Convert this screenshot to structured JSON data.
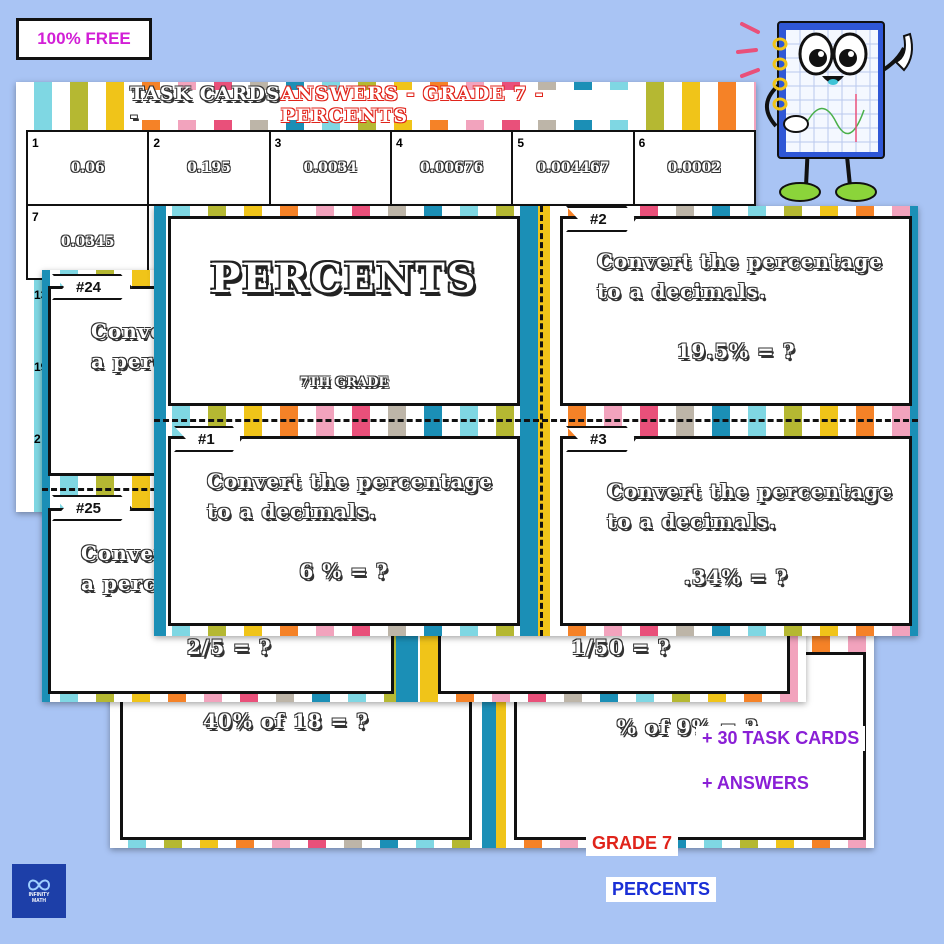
{
  "badge": {
    "free": "100% FREE"
  },
  "answers_sheet": {
    "title_part1": "TASK CARDS -",
    "title_part2": " ANSWERS - GRADE 7 - PERCENTS",
    "row1": [
      {
        "n": "1",
        "v": "0.06"
      },
      {
        "n": "2",
        "v": "0.195"
      },
      {
        "n": "3",
        "v": "0.0034"
      },
      {
        "n": "4",
        "v": "0.00676"
      },
      {
        "n": "5",
        "v": "0.004467"
      },
      {
        "n": "6",
        "v": "0.0002"
      }
    ],
    "row2_first": {
      "n": "7",
      "v": "0.0345"
    },
    "left_nums": [
      "13",
      "19",
      "2"
    ]
  },
  "back_sheet": {
    "card_a_text": "40% of 18 = ?",
    "card_b_text": "% of 9% = ?"
  },
  "mid_sheet": {
    "tag_24": "#24",
    "text_24_line1": "Conve",
    "text_24_line2": "a perc",
    "tag_25": "#25",
    "text_25_line1": "Conver",
    "text_25_line2": "a perce",
    "frag_25": "2/5 = ?",
    "frag_right": "1/50 = ?"
  },
  "front_sheet": {
    "cover_title": "PERCENTS",
    "cover_grade": "7TH GRADE",
    "card1": {
      "tag": "#1",
      "line1": "Convert the percentage",
      "line2": "to a decimals.",
      "question": "6 % = ?"
    },
    "card2": {
      "tag": "#2",
      "line1": "Convert the percentage",
      "line2": "to a decimals.",
      "question": "19.5% = ?"
    },
    "card3": {
      "tag": "#3",
      "line1": "Convert the percentage",
      "line2": "to a decimals.",
      "question": ".34% = ?"
    }
  },
  "promo": {
    "task_cards": "+    30 TASK CARDS",
    "answers": "+     ANSWERS",
    "grade": "GRADE 7",
    "topic": "PERCENTS"
  },
  "logo": {
    "line1": "INFINITY",
    "line2": "MATH"
  },
  "colors": {
    "background": "#a9c4f4",
    "free_text": "#d21fd6",
    "purple": "#8a1fd6",
    "red": "#e0241b",
    "blue": "#1a2fd6",
    "teal": "#1b8fb6"
  }
}
